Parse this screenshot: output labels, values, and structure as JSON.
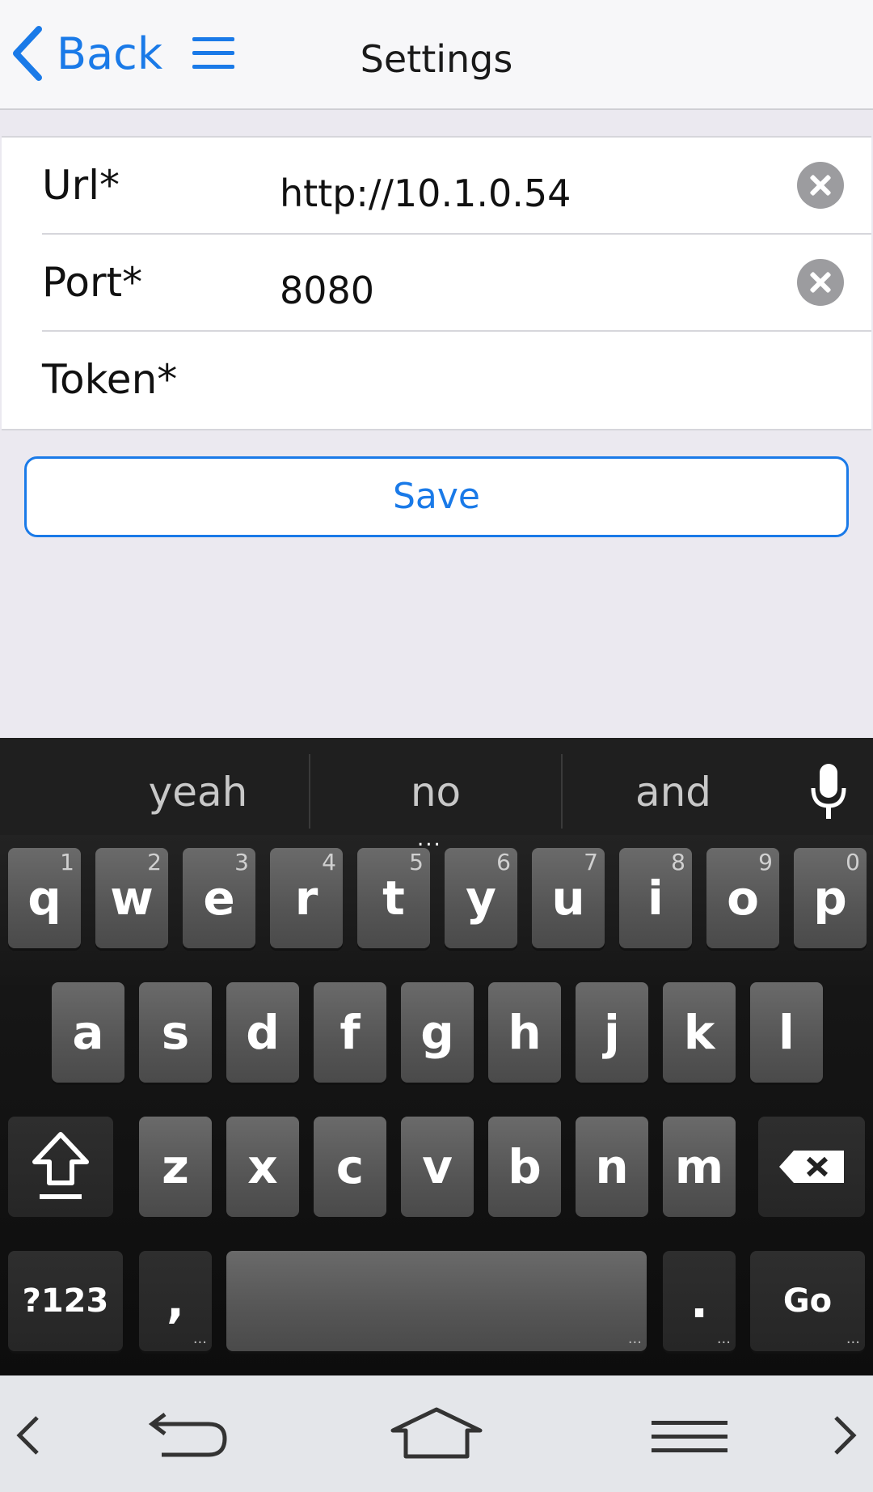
{
  "header": {
    "back_label": "Back",
    "title": "Settings"
  },
  "form": {
    "fields": [
      {
        "label": "Url*",
        "value": "http://10.1.0.54"
      },
      {
        "label": "Port*",
        "value": "8080"
      },
      {
        "label": "Token*",
        "value": ""
      }
    ],
    "save_label": "Save"
  },
  "keyboard": {
    "suggestions": [
      "yeah",
      "no",
      "and"
    ],
    "suggestion_more": "...",
    "row1": [
      {
        "key": "q",
        "num": "1"
      },
      {
        "key": "w",
        "num": "2"
      },
      {
        "key": "e",
        "num": "3"
      },
      {
        "key": "r",
        "num": "4"
      },
      {
        "key": "t",
        "num": "5"
      },
      {
        "key": "y",
        "num": "6"
      },
      {
        "key": "u",
        "num": "7"
      },
      {
        "key": "i",
        "num": "8"
      },
      {
        "key": "o",
        "num": "9"
      },
      {
        "key": "p",
        "num": "0"
      }
    ],
    "row2": [
      "a",
      "s",
      "d",
      "f",
      "g",
      "h",
      "j",
      "k",
      "l"
    ],
    "row3": [
      "z",
      "x",
      "c",
      "v",
      "b",
      "n",
      "m"
    ],
    "symbols_label": "?123",
    "comma_label": ",",
    "period_label": ".",
    "go_label": "Go",
    "more_dots": "..."
  },
  "icons": {
    "back": "chevron-left-icon",
    "menu": "hamburger-menu-icon",
    "clear": "clear-circle-icon",
    "mic": "microphone-icon",
    "shift": "shift-arrow-icon",
    "backspace": "backspace-icon",
    "nav_prev": "chevron-left-icon",
    "nav_back": "return-arrow-icon",
    "nav_home": "home-icon",
    "nav_menu": "menu-lines-icon",
    "nav_next": "chevron-right-icon"
  },
  "colors": {
    "accent": "#1a7ae8",
    "keyboard_bg": "#111111",
    "key_bg": "#5a5a5a"
  }
}
